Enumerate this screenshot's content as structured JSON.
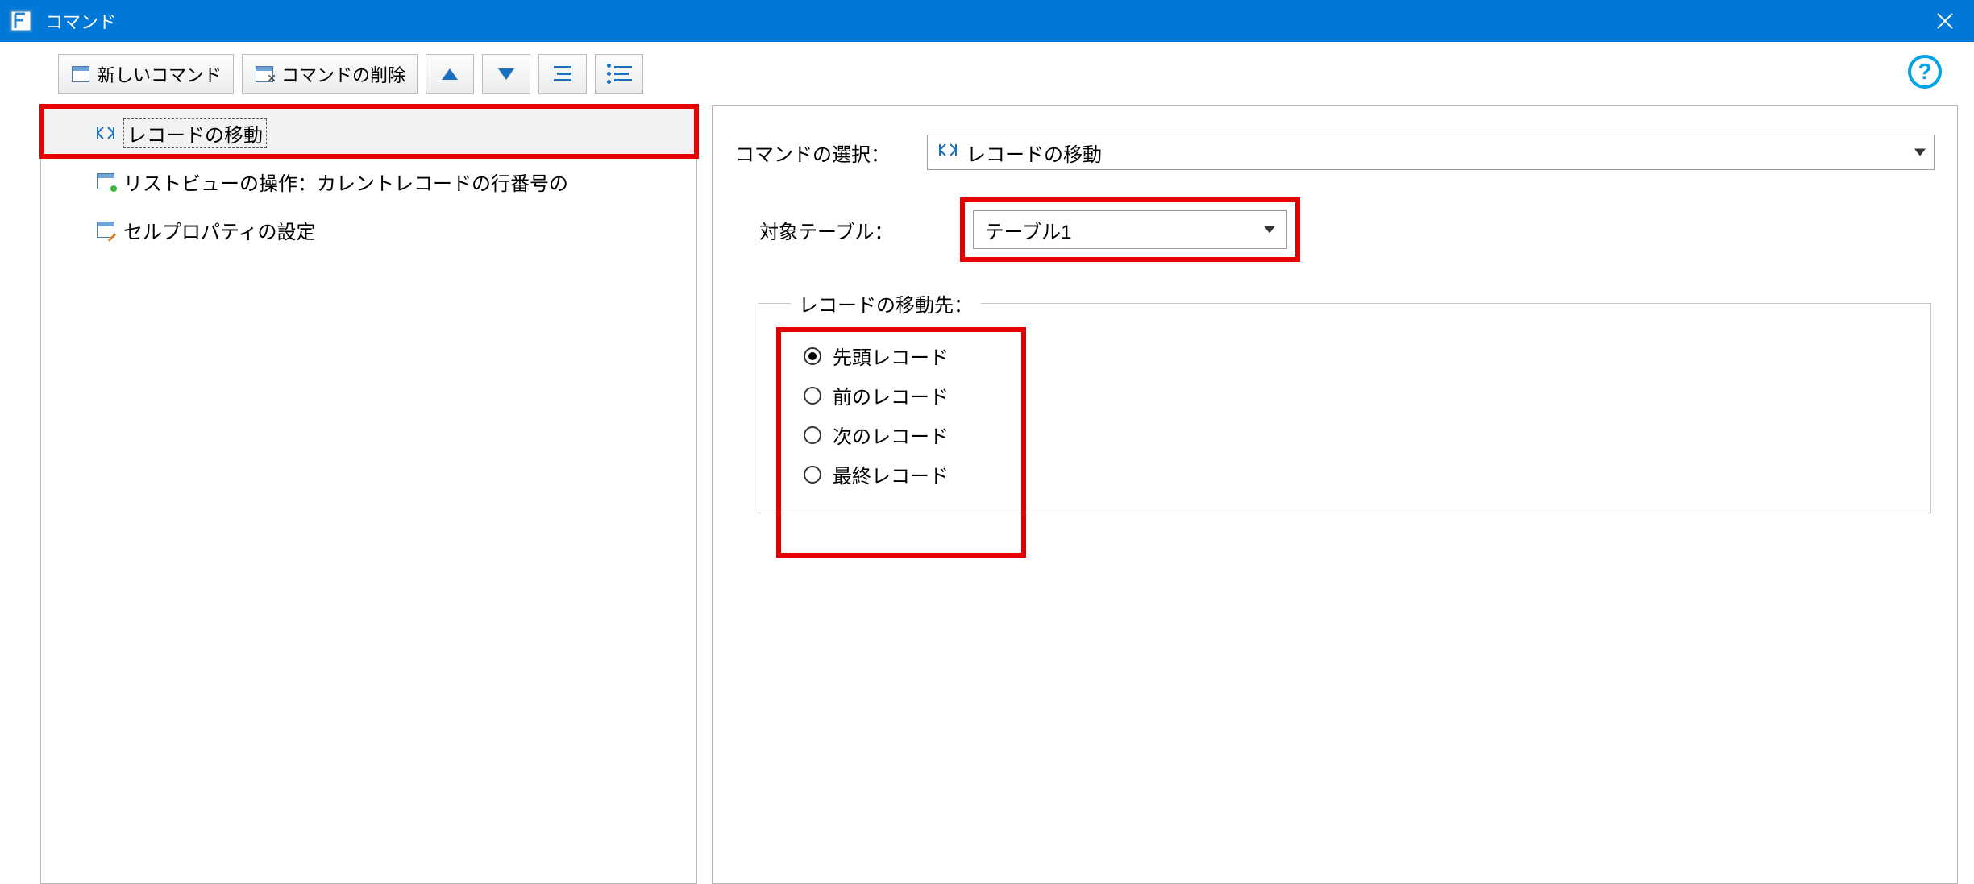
{
  "titlebar": {
    "title": "コマンド"
  },
  "toolbar": {
    "new_command_label": "新しいコマンド",
    "delete_command_label": "コマンドの削除"
  },
  "tree": {
    "items": [
      {
        "label": "レコードの移動"
      },
      {
        "label": "リストビューの操作：カレントレコードの行番号の"
      },
      {
        "label": "セルプロパティの設定"
      }
    ]
  },
  "details": {
    "command_select_label": "コマンドの選択：",
    "command_select_value": "レコードの移動",
    "target_table_label": "対象テーブル：",
    "target_table_value": "テーブル1",
    "destination_legend": "レコードの移動先：",
    "radios": {
      "first": "先頭レコード",
      "prev": "前のレコード",
      "next": "次のレコード",
      "last": "最終レコード"
    }
  }
}
